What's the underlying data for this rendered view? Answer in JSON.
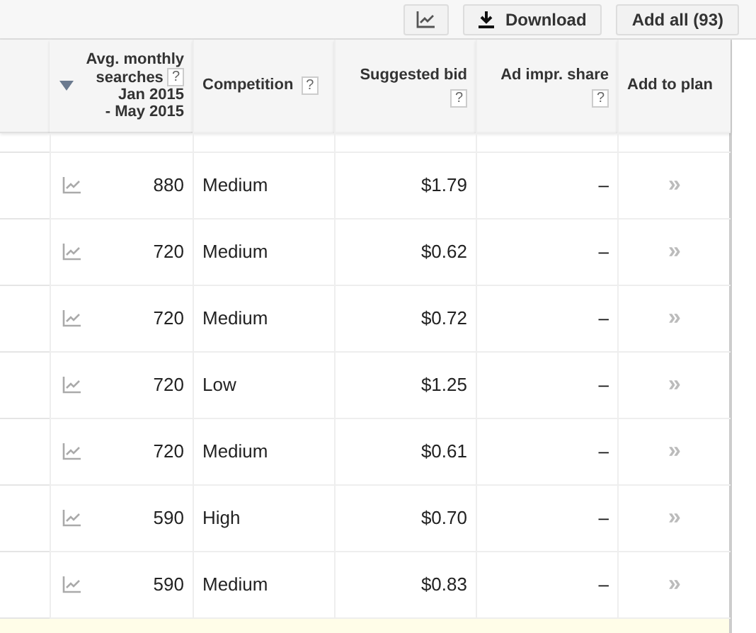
{
  "toolbar": {
    "download": "Download",
    "add_all": "Add all (93)"
  },
  "table": {
    "columns": [
      {
        "label": "Avg. monthly searches",
        "help": "?",
        "dates": [
          "Jan 2015",
          "- May 2015"
        ],
        "sorted": true
      },
      {
        "label": "Competition",
        "help": "?"
      },
      {
        "label": "Suggested bid",
        "help": "?"
      },
      {
        "label": "Ad impr. share",
        "help": "?"
      },
      {
        "label": "Add to plan"
      }
    ],
    "rows": [
      {
        "searches": "880",
        "competition": "Medium",
        "bid": "$1.79",
        "share": "–",
        "add": "»"
      },
      {
        "searches": "720",
        "competition": "Medium",
        "bid": "$0.62",
        "share": "–",
        "add": "»"
      },
      {
        "searches": "720",
        "competition": "Medium",
        "bid": "$0.72",
        "share": "–",
        "add": "»"
      },
      {
        "searches": "720",
        "competition": "Low",
        "bid": "$1.25",
        "share": "–",
        "add": "»"
      },
      {
        "searches": "720",
        "competition": "Medium",
        "bid": "$0.61",
        "share": "–",
        "add": "»"
      },
      {
        "searches": "590",
        "competition": "High",
        "bid": "$0.70",
        "share": "–",
        "add": "»"
      },
      {
        "searches": "590",
        "competition": "Medium",
        "bid": "$0.83",
        "share": "–",
        "add": "»"
      }
    ]
  }
}
